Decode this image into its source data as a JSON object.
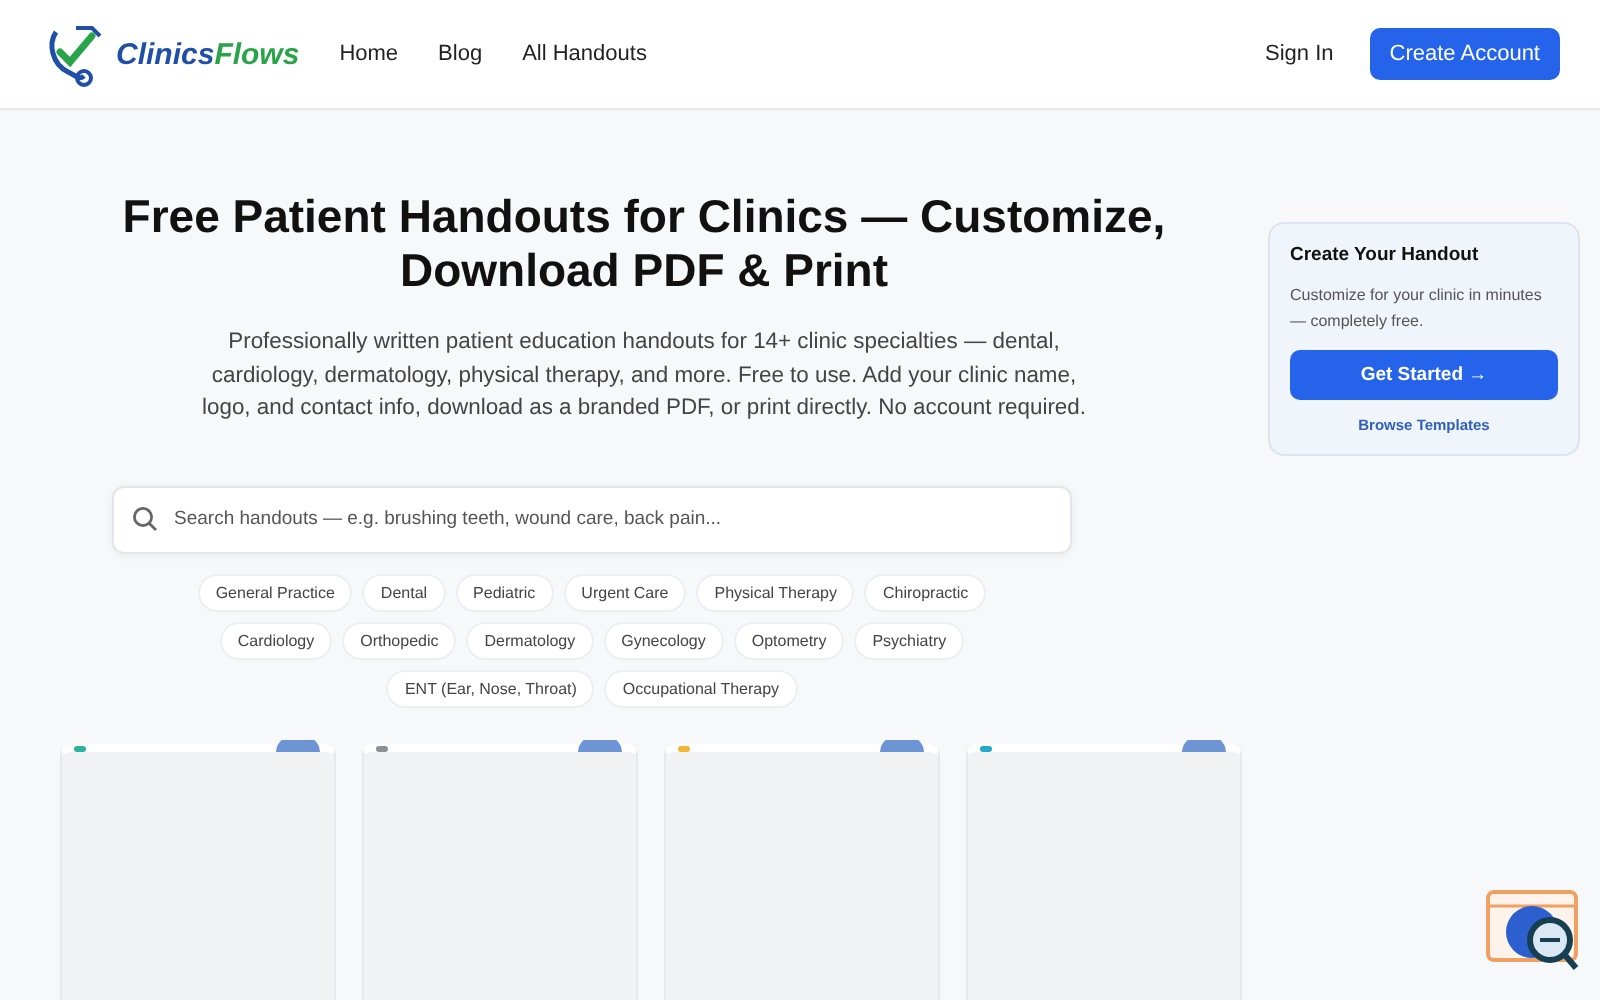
{
  "header": {
    "logo": {
      "first": "Clinics",
      "second": "Flows"
    },
    "nav": [
      {
        "label": "Home"
      },
      {
        "label": "Blog"
      },
      {
        "label": "All Handouts"
      }
    ],
    "sign_in": "Sign In",
    "create_account": "Create Account"
  },
  "hero": {
    "title": "Free Patient Handouts for Clinics — Customize, Download PDF & Print",
    "description": "Professionally written patient education handouts for 14+ clinic specialties — dental, cardiology, dermatology, physical therapy, and more. Free to use. Add your clinic name, logo, and contact info, download as a branded PDF, or print directly. No account required."
  },
  "search": {
    "placeholder": "Search handouts — e.g. brushing teeth, wound care, back pain..."
  },
  "categories": [
    {
      "label": "General Practice"
    },
    {
      "label": "Dental"
    },
    {
      "label": "Pediatric"
    },
    {
      "label": "Urgent Care"
    },
    {
      "label": "Physical Therapy"
    },
    {
      "label": "Chiropractic"
    },
    {
      "label": "Cardiology"
    },
    {
      "label": "Orthopedic"
    },
    {
      "label": "Dermatology"
    },
    {
      "label": "Gynecology"
    },
    {
      "label": "Optometry"
    },
    {
      "label": "Psychiatry"
    },
    {
      "label": "ENT (Ear, Nose, Throat)"
    },
    {
      "label": "Occupational Therapy"
    }
  ],
  "cards": [
    {
      "color": "#2bb3a0"
    },
    {
      "color": "#8a8f98"
    },
    {
      "color": "#f2b632"
    },
    {
      "color": "#22a8c8"
    }
  ],
  "sidebar": {
    "title": "Create Your Handout",
    "text": "Customize for your clinic in minutes — completely free.",
    "button": "Get Started →",
    "link": "Browse Templates"
  }
}
